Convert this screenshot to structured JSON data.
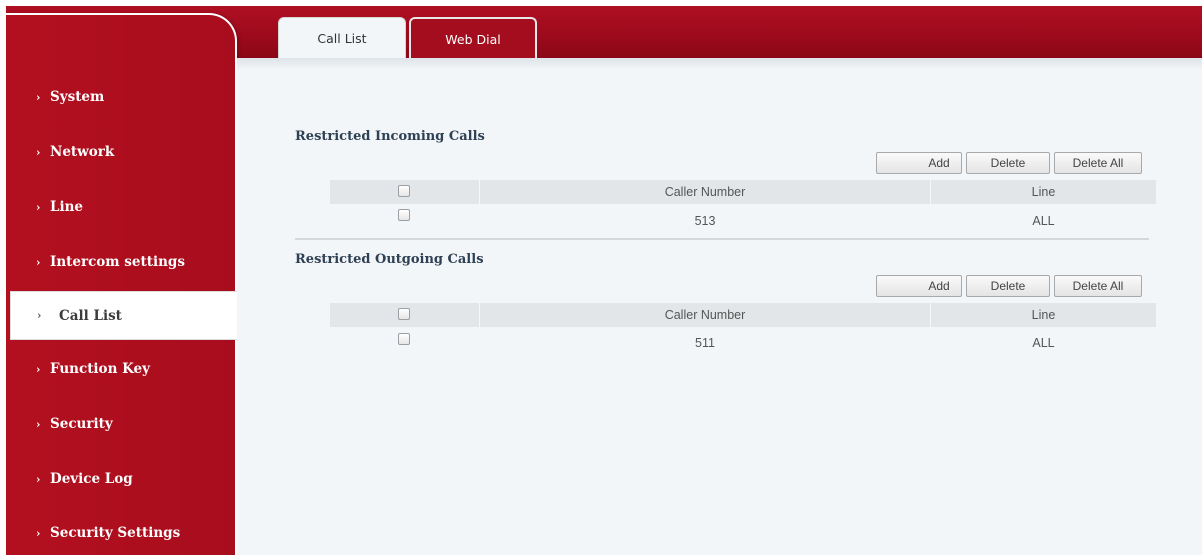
{
  "tabs": [
    {
      "label": "Call List"
    },
    {
      "label": "Web Dial"
    }
  ],
  "sidebar": {
    "items": [
      {
        "label": "System"
      },
      {
        "label": "Network"
      },
      {
        "label": "Line"
      },
      {
        "label": "Intercom settings"
      },
      {
        "label": "Call List",
        "active": true
      },
      {
        "label": "Function Key"
      },
      {
        "label": "Security"
      },
      {
        "label": "Device Log"
      },
      {
        "label": "Security Settings"
      }
    ],
    "chevron": "›"
  },
  "incoming": {
    "title": "Restricted Incoming Calls",
    "buttons": {
      "add": "Add",
      "delete": "Delete",
      "delete_all": "Delete All"
    },
    "columns": {
      "number": "Caller Number",
      "line": "Line"
    },
    "rows": [
      {
        "number": "513",
        "line": "ALL"
      }
    ]
  },
  "outgoing": {
    "title": "Restricted Outgoing Calls",
    "buttons": {
      "add": "Add",
      "delete": "Delete",
      "delete_all": "Delete All"
    },
    "columns": {
      "number": "Caller Number",
      "line": "Line"
    },
    "rows": [
      {
        "number": "511",
        "line": "ALL"
      }
    ]
  },
  "colors": {
    "brand": "#a40d1d",
    "content_bg": "#f3f6f8",
    "table_header": "#e2e6e9"
  }
}
